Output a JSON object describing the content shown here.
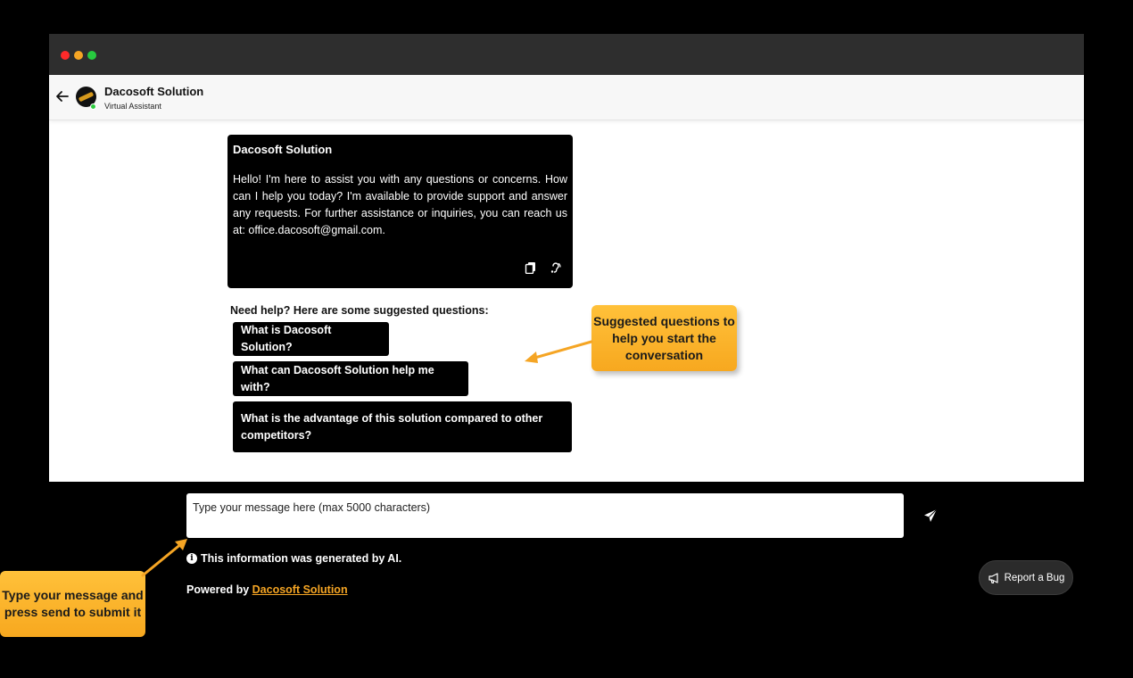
{
  "window": {
    "traffic_lights": [
      "close",
      "minimize",
      "maximize"
    ]
  },
  "header": {
    "title": "Dacosoft Solution",
    "subtitle": "Virtual Assistant",
    "back_icon": "arrow-left-icon",
    "status": "online"
  },
  "message": {
    "sender": "Dacosoft Solution",
    "text": "Hello! I'm here to assist you with any questions or concerns. How can I help you today? I'm available to provide support and answer any requests. For further assistance or inquiries, you can reach us at: office.dacosoft@gmail.com.",
    "actions": [
      "copy-icon",
      "speaker-icon"
    ]
  },
  "suggestions": {
    "heading": "Need help? Here are some suggested questions:",
    "items": [
      "What is Dacosoft Solution?",
      "What can Dacosoft Solution help me with?",
      "What is the advantage of this solution compared to other competitors?"
    ]
  },
  "composer": {
    "placeholder": "Type your message here (max 5000 characters)",
    "send_icon": "send-icon"
  },
  "footer": {
    "ai_note": "This information was generated by AI.",
    "powered_prefix": "Powered by ",
    "powered_link": "Dacosoft Solution"
  },
  "report_bug": {
    "label": "Report a Bug",
    "icon": "megaphone-icon"
  },
  "callouts": {
    "suggested": "Suggested questions to help you start the conversation",
    "composer": "Type your message and press send to submit it"
  },
  "colors": {
    "accent": "#f5a524",
    "online": "#2ecc40",
    "bubble": "#000000"
  }
}
